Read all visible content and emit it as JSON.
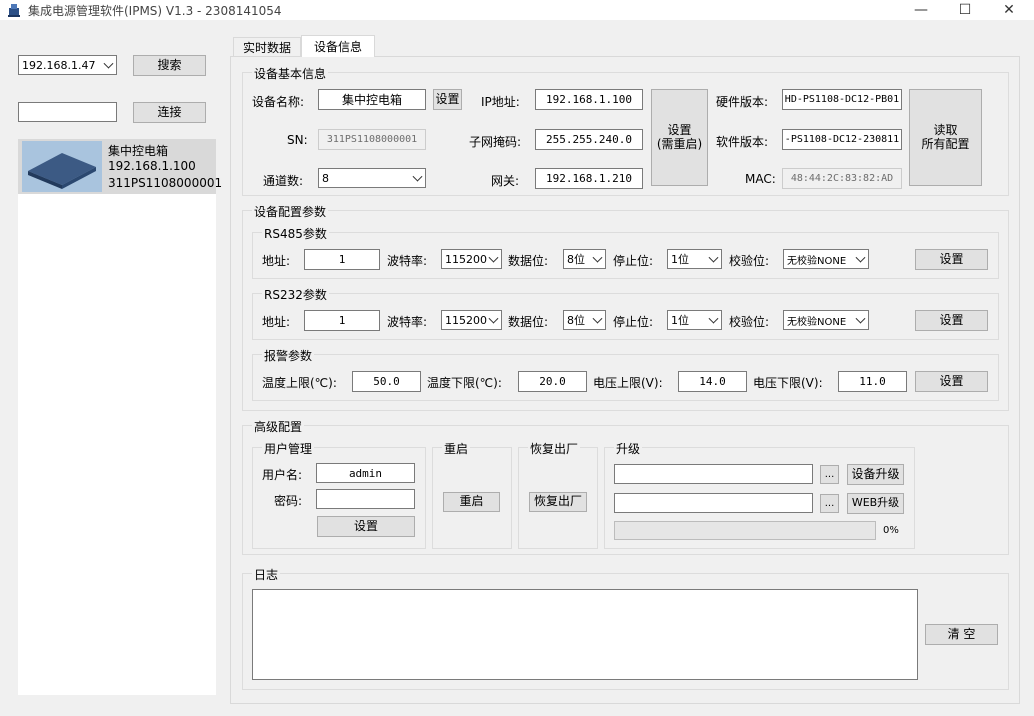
{
  "window": {
    "title": "集成电源管理软件(IPMS) V1.3 - 2308141054",
    "minimize_glyph": "—",
    "maximize_glyph": "☐",
    "close_glyph": "✕"
  },
  "left": {
    "ip_select": "192.168.1.47",
    "search_btn": "搜索",
    "connect_input": "",
    "connect_btn": "连接",
    "devices": [
      {
        "name": "集中控电箱",
        "ip": "192.168.1.100",
        "sn": "311PS1108000001"
      }
    ]
  },
  "tabs": [
    {
      "label": "实时数据"
    },
    {
      "label": "设备信息"
    }
  ],
  "basic": {
    "group_title": "设备基本信息",
    "name_label": "设备名称:",
    "name_value": "集中控电箱",
    "name_set_btn": "设置",
    "sn_label": "SN:",
    "sn_value": "311PS1108000001",
    "channels_label": "通道数:",
    "channels_value": "8",
    "ip_label": "IP地址:",
    "ip_value": "192.168.1.100",
    "mask_label": "子网掩码:",
    "mask_value": "255.255.240.0",
    "gateway_label": "网关:",
    "gateway_value": "192.168.1.210",
    "net_set_btn_line1": "设置",
    "net_set_btn_line2": "(需重启)",
    "hw_label": "硬件版本:",
    "hw_value": "HD-PS1108-DC12-PB01",
    "sw_label": "软件版本:",
    "sw_value": "-PS1108-DC12-230811",
    "mac_label": "MAC:",
    "mac_value": "48:44:2C:83:82:AD",
    "read_btn_line1": "读取",
    "read_btn_line2": "所有配置"
  },
  "config": {
    "group_title": "设备配置参数",
    "rs485": {
      "title": "RS485参数",
      "addr_label": "地址:",
      "addr_value": "1",
      "baud_label": "波特率:",
      "baud_value": "115200",
      "data_label": "数据位:",
      "data_value": "8位",
      "stop_label": "停止位:",
      "stop_value": "1位",
      "parity_label": "校验位:",
      "parity_value": "无校验NONE",
      "set_btn": "设置"
    },
    "rs232": {
      "title": "RS232参数",
      "addr_label": "地址:",
      "addr_value": "1",
      "baud_label": "波特率:",
      "baud_value": "115200",
      "data_label": "数据位:",
      "data_value": "8位",
      "stop_label": "停止位:",
      "stop_value": "1位",
      "parity_label": "校验位:",
      "parity_value": "无校验NONE",
      "set_btn": "设置"
    },
    "alarm": {
      "title": "报警参数",
      "temp_hi_label": "温度上限(℃):",
      "temp_hi_value": "50.0",
      "temp_lo_label": "温度下限(℃):",
      "temp_lo_value": "20.0",
      "volt_hi_label": "电压上限(V):",
      "volt_hi_value": "14.0",
      "volt_lo_label": "电压下限(V):",
      "volt_lo_value": "11.0",
      "set_btn": "设置"
    }
  },
  "advanced": {
    "group_title": "高级配置",
    "user": {
      "title": "用户管理",
      "username_label": "用户名:",
      "username_value": "admin",
      "password_label": "密码:",
      "password_value": "",
      "set_btn": "设置"
    },
    "reboot": {
      "title": "重启",
      "btn": "重启"
    },
    "factory": {
      "title": "恢复出厂",
      "btn": "恢复出厂"
    },
    "upgrade": {
      "title": "升级",
      "device_file": "",
      "web_file": "",
      "browse_label": "...",
      "device_btn": "设备升级",
      "web_btn": "WEB升级",
      "progress_text": "0%",
      "progress": 0
    }
  },
  "log": {
    "group_title": "日志",
    "content": "",
    "clear_btn": "清 空"
  },
  "colors": {
    "panel_bg": "#f0f0f0",
    "button_bg": "#e1e1e1",
    "selected_item_bg": "#d9d9d9"
  }
}
